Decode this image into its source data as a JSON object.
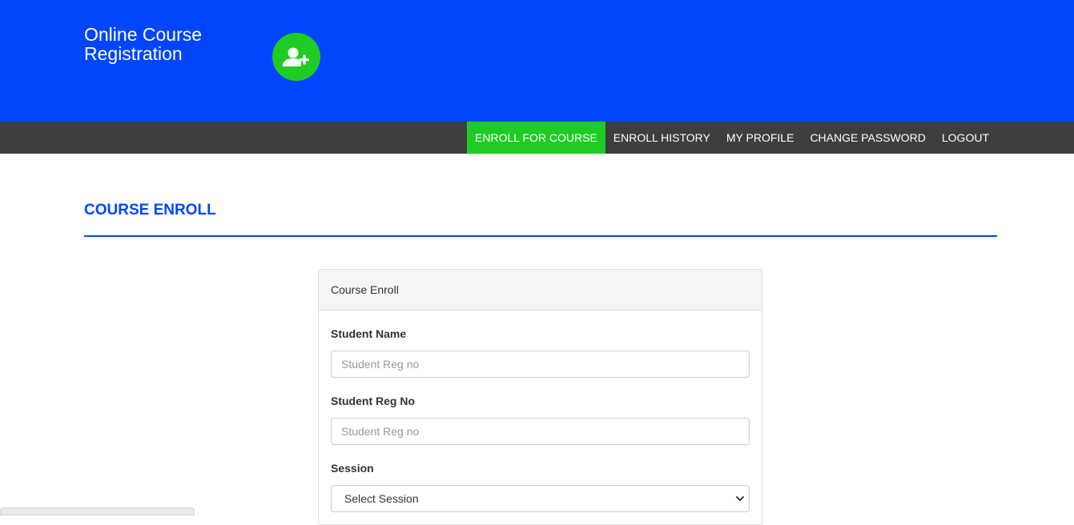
{
  "header": {
    "brand_line1": "Online Course",
    "brand_line2": "Registration",
    "logo_icon": "user-plus-icon",
    "bg_color": "#0245fd",
    "logo_color": "#1fcc23"
  },
  "nav": {
    "items": [
      {
        "label": "ENROLL FOR COURSE",
        "active": true
      },
      {
        "label": "ENROLL HISTORY",
        "active": false
      },
      {
        "label": "MY PROFILE",
        "active": false
      },
      {
        "label": "CHANGE PASSWORD",
        "active": false
      },
      {
        "label": "LOGOUT",
        "active": false
      }
    ],
    "bg_color": "#3e3e3e",
    "active_color": "#1fcc23"
  },
  "page": {
    "title": "COURSE ENROLL"
  },
  "panel": {
    "heading": "Course Enroll",
    "student_name": {
      "label": "Student Name",
      "placeholder": "Student Reg no",
      "value": ""
    },
    "student_reg_no": {
      "label": "Student Reg No",
      "placeholder": "Student Reg no",
      "value": ""
    },
    "session": {
      "label": "Session",
      "selected": "Select Session",
      "icon": "chevron-down-icon"
    }
  }
}
